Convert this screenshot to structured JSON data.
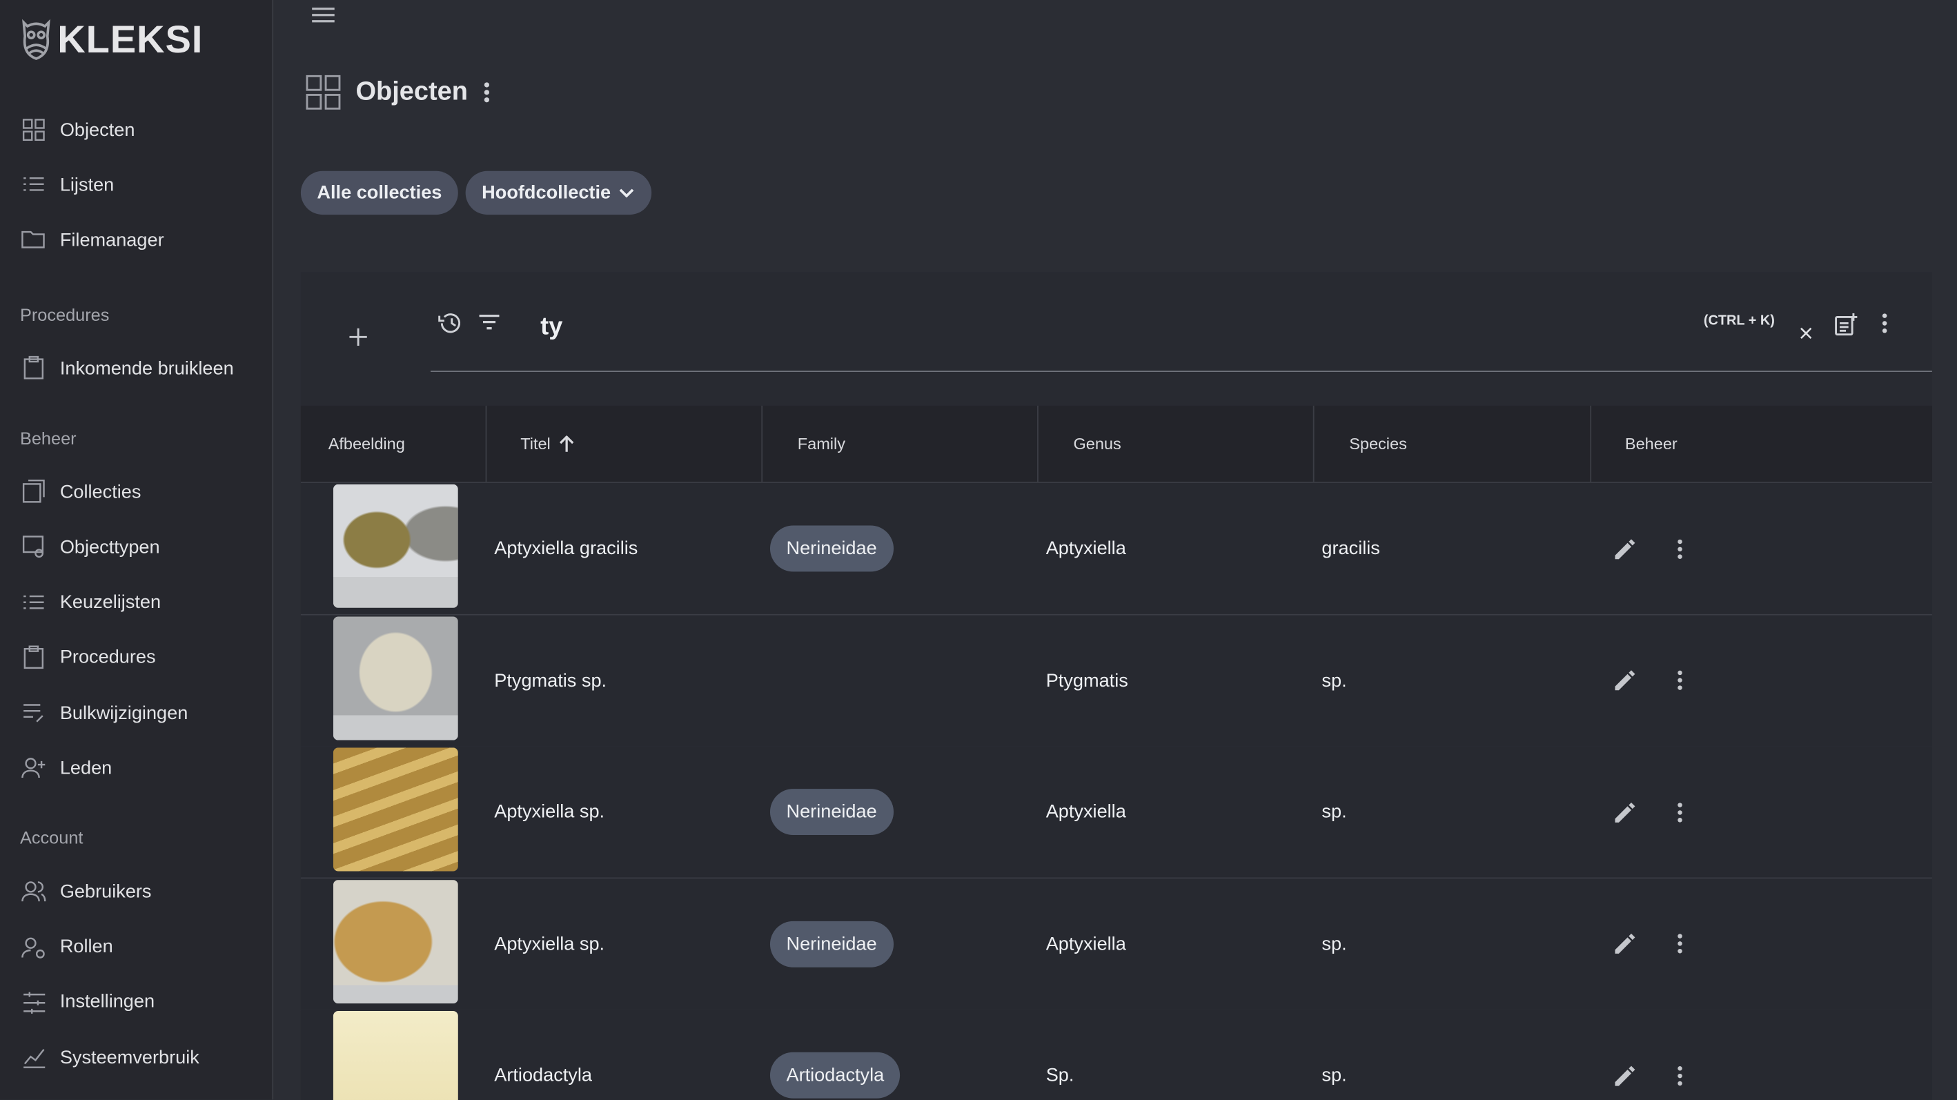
{
  "app": {
    "logo": "KLEKSI"
  },
  "sidebar": {
    "items_top": [
      {
        "label": "Objecten",
        "icon": "grid-icon"
      },
      {
        "label": "Lijsten",
        "icon": "list-icon"
      },
      {
        "label": "Filemanager",
        "icon": "folder-icon"
      }
    ],
    "sections": [
      {
        "title": "Procedures",
        "items": [
          {
            "label": "Inkomende bruikleen",
            "icon": "clipboard-icon"
          }
        ]
      },
      {
        "title": "Beheer",
        "items": [
          {
            "label": "Collecties",
            "icon": "collection-icon"
          },
          {
            "label": "Objecttypen",
            "icon": "objecttype-icon"
          },
          {
            "label": "Keuzelijsten",
            "icon": "list-icon"
          },
          {
            "label": "Procedures",
            "icon": "clipboard-icon"
          },
          {
            "label": "Bulkwijzigingen",
            "icon": "bulk-edit-icon"
          },
          {
            "label": "Leden",
            "icon": "add-user-icon"
          }
        ]
      },
      {
        "title": "Account",
        "items": [
          {
            "label": "Gebruikers",
            "icon": "users-icon"
          },
          {
            "label": "Rollen",
            "icon": "user-gear-icon"
          },
          {
            "label": "Instellingen",
            "icon": "sliders-icon"
          },
          {
            "label": "Systeemverbruik",
            "icon": "chart-icon"
          }
        ]
      }
    ]
  },
  "header": {
    "title": "Objecten"
  },
  "filters": {
    "all": "Alle collecties",
    "selected": "Hoofdcollectie"
  },
  "search": {
    "value": "ty",
    "shortcut": "(CTRL + K)"
  },
  "table": {
    "columns": [
      "Afbeelding",
      "Titel",
      "Family",
      "Genus",
      "Species",
      "Beheer"
    ],
    "rows": [
      {
        "title": "Aptyxiella gracilis",
        "family": "Nerineidae",
        "genus": "Aptyxiella",
        "species": "gracilis"
      },
      {
        "title": "Ptygmatis sp.",
        "family": "",
        "genus": "Ptygmatis",
        "species": "sp."
      },
      {
        "title": "Aptyxiella sp.",
        "family": "Nerineidae",
        "genus": "Aptyxiella",
        "species": "sp."
      },
      {
        "title": "Aptyxiella sp.",
        "family": "Nerineidae",
        "genus": "Aptyxiella",
        "species": "sp."
      },
      {
        "title": "Artiodactyla",
        "family": "Artiodactyla",
        "genus": "Sp.",
        "species": "sp."
      }
    ]
  }
}
